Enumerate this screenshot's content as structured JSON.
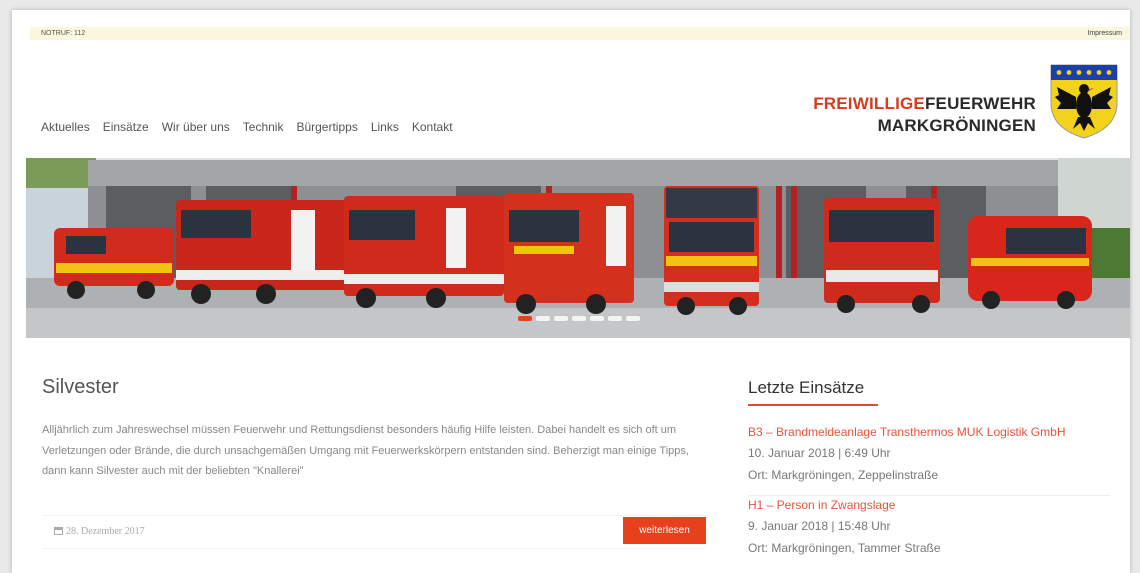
{
  "topbar": {
    "notruf": "NOTRUF: 112",
    "impressum": "Impressum"
  },
  "nav": {
    "items": [
      "Aktuelles",
      "Einsätze",
      "Wir über uns",
      "Technik",
      "Bürgertipps",
      "Links",
      "Kontakt"
    ]
  },
  "logo": {
    "line1_red": "FREIWILLIGE",
    "line1_dark": "FEUERWEHR",
    "line2": "MARKGRÖNINGEN"
  },
  "post": {
    "title": "Silvester",
    "text": "Alljährlich zum Jahreswechsel müssen Feuerwehr und Rettungsdienst besonders häufig Hilfe leisten. Dabei handelt es sich oft um Verletzungen oder Brände, die durch unsachgemäßen Umgang mit Feuerwerkskörpern entstanden sind. Beherzigt man einige Tipps, dann kann Silvester auch mit der beliebten \"Knallerei\"",
    "date": "28. Dezember 2017",
    "more_label": "weiterlesen"
  },
  "sidebar": {
    "heading": "Letzte Einsätze",
    "incidents": [
      {
        "title": "B3 – Brandmeldeanlage Transthermos MUK Logistik GmbH",
        "datetime": "10. Januar 2018 | 6:49 Uhr",
        "location": "Ort: Markgröningen, Zeppelinstraße"
      },
      {
        "title": "H1 – Person in Zwangslage",
        "datetime": "9. Januar 2018 | 15:48 Uhr",
        "location": "Ort: Markgröningen, Tammer Straße"
      }
    ]
  },
  "colors": {
    "accent": "#e8401c",
    "banner": "#fbf7de",
    "crest_blue": "#1f3fa8",
    "crest_yellow": "#f3d21b"
  }
}
